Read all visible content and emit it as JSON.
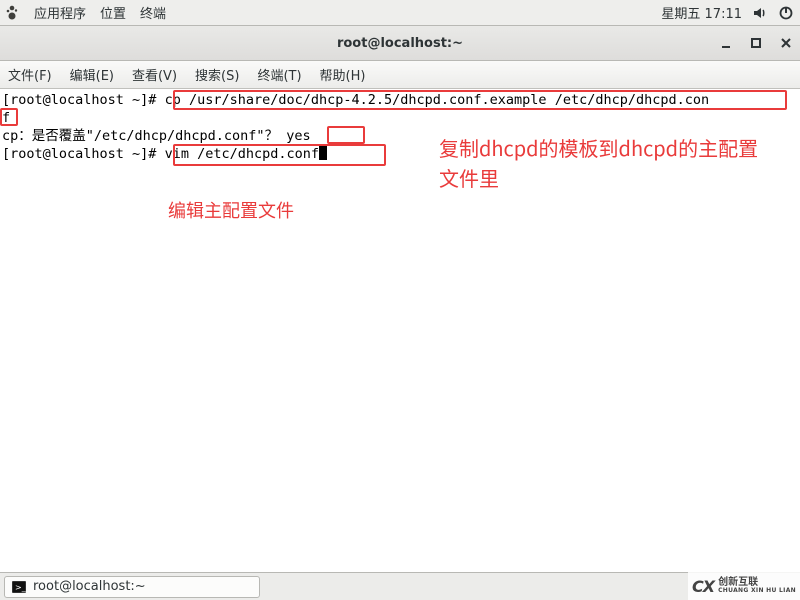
{
  "topbar": {
    "apps": "应用程序",
    "places": "位置",
    "terminal": "终端",
    "clock": "星期五 17:11"
  },
  "window_title": "root@localhost:~",
  "menubar": {
    "file": "文件(F)",
    "edit": "编辑(E)",
    "view": "查看(V)",
    "search": "搜索(S)",
    "terminal": "终端(T)",
    "help": "帮助(H)"
  },
  "terminal": {
    "line1a": "[root@localhost ~]# ",
    "line1b": "cp /usr/share/doc/dhcp-4.2.5/dhcpd.conf.example /etc/dhcp/dhcpd.con",
    "line2a": "f",
    "line3a": "cp：是否覆盖\"/etc/dhcp/dhcpd.conf\"？ ",
    "line3b": "yes",
    "line4a": "[root@localhost ~]# ",
    "line4b": "vim /etc/dhcpd.conf"
  },
  "annotations": {
    "right": "复制dhcpd的模板到dhcpd的主配置文件里",
    "right_l1": "复制dhcpd的模板到dhcpd的主配置",
    "right_l2": "文件里",
    "left": "编辑主配置文件"
  },
  "taskbar": {
    "title": "root@localhost:~"
  },
  "watermark": {
    "cx": "CX",
    "cn": "创新互联",
    "en": "CHUANG XIN HU LIAN"
  }
}
